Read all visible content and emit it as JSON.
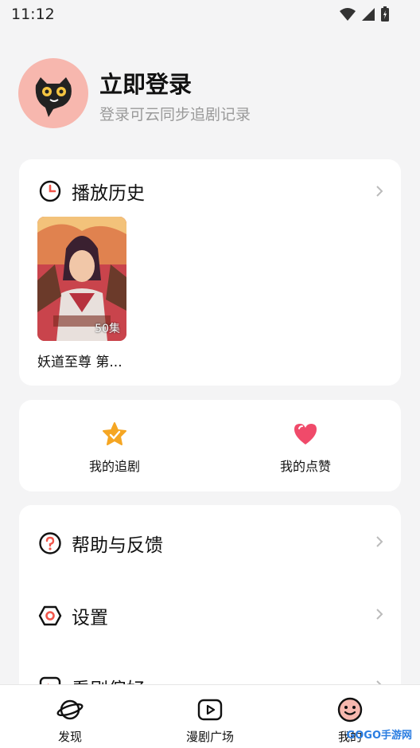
{
  "status": {
    "time": "11:12"
  },
  "profile": {
    "title": "立即登录",
    "subtitle": "登录可云同步追剧记录"
  },
  "history": {
    "label": "播放历史",
    "items": [
      {
        "title": "妖道至尊 第...",
        "episodes": "50集"
      }
    ]
  },
  "quick": [
    {
      "label": "我的追剧",
      "icon": "star-icon"
    },
    {
      "label": "我的点赞",
      "icon": "heart-icon"
    }
  ],
  "menu": [
    {
      "label": "帮助与反馈",
      "icon": "help-icon"
    },
    {
      "label": "设置",
      "icon": "settings-icon"
    },
    {
      "label": "看剧偏好",
      "icon": "preference-icon"
    }
  ],
  "nav": [
    {
      "label": "发现"
    },
    {
      "label": "漫剧广场"
    },
    {
      "label": "我的"
    }
  ],
  "watermark": "GOGO手游网",
  "colors": {
    "accent": "#f2564b",
    "star": "#f5a623",
    "heart": "#f04a6a"
  }
}
